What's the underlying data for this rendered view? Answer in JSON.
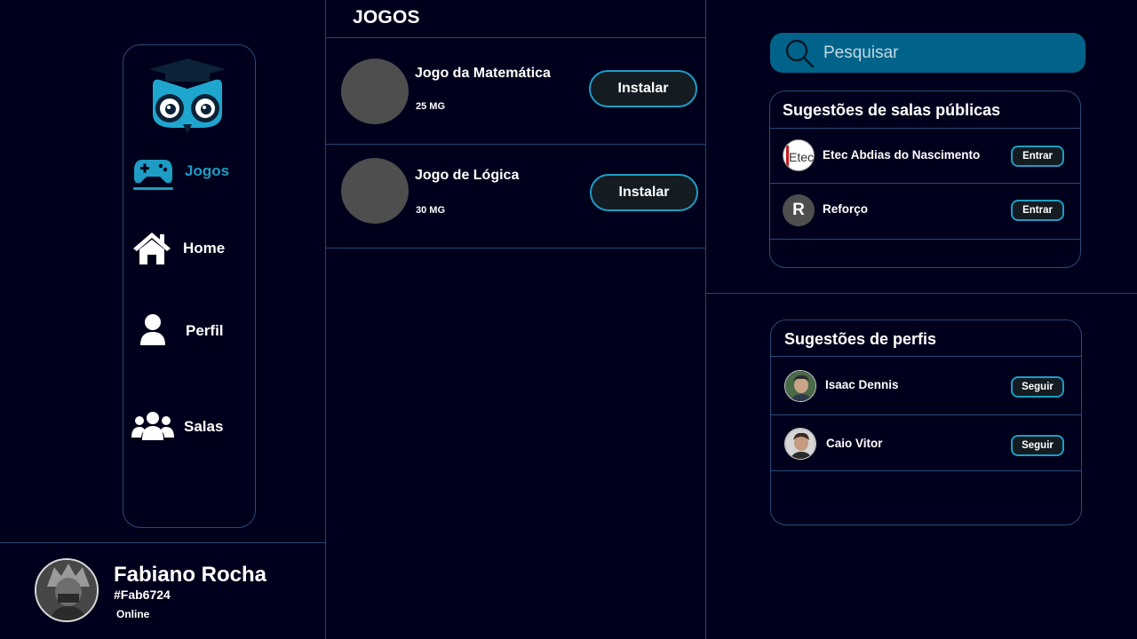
{
  "nav": {
    "items": [
      {
        "label": "Jogos",
        "icon": "gamepad-icon",
        "active": true
      },
      {
        "label": "Home",
        "icon": "home-icon"
      },
      {
        "label": "Perfil",
        "icon": "user-icon"
      },
      {
        "label": "Salas",
        "icon": "group-icon"
      }
    ]
  },
  "profile": {
    "name": "Fabiano Rocha",
    "tag": "#Fab6724",
    "status": "Online"
  },
  "games": {
    "title": "JOGOS",
    "items": [
      {
        "name": "Jogo da Matemática",
        "size": "25 MG",
        "button": "Instalar"
      },
      {
        "name": "Jogo de Lógica",
        "size": "30 MG",
        "button": "Instalar"
      }
    ]
  },
  "search": {
    "placeholder": "Pesquisar"
  },
  "rooms": {
    "title": "Sugestões de salas públicas",
    "items": [
      {
        "name": "Etec Abdias do Nascimento",
        "button": "Entrar",
        "avatar_text": "Etec"
      },
      {
        "name": "Reforço",
        "button": "Entrar",
        "avatar_text": "R"
      }
    ]
  },
  "profiles": {
    "title": "Sugestões de perfis",
    "items": [
      {
        "name": "Isaac Dennis",
        "button": "Seguir"
      },
      {
        "name": "Caio Vitor",
        "button": "Seguir"
      }
    ]
  },
  "colors": {
    "background": "#00001c",
    "accent": "#1e9cc4",
    "search_bg": "#02638a",
    "border": "#2c4a78"
  }
}
